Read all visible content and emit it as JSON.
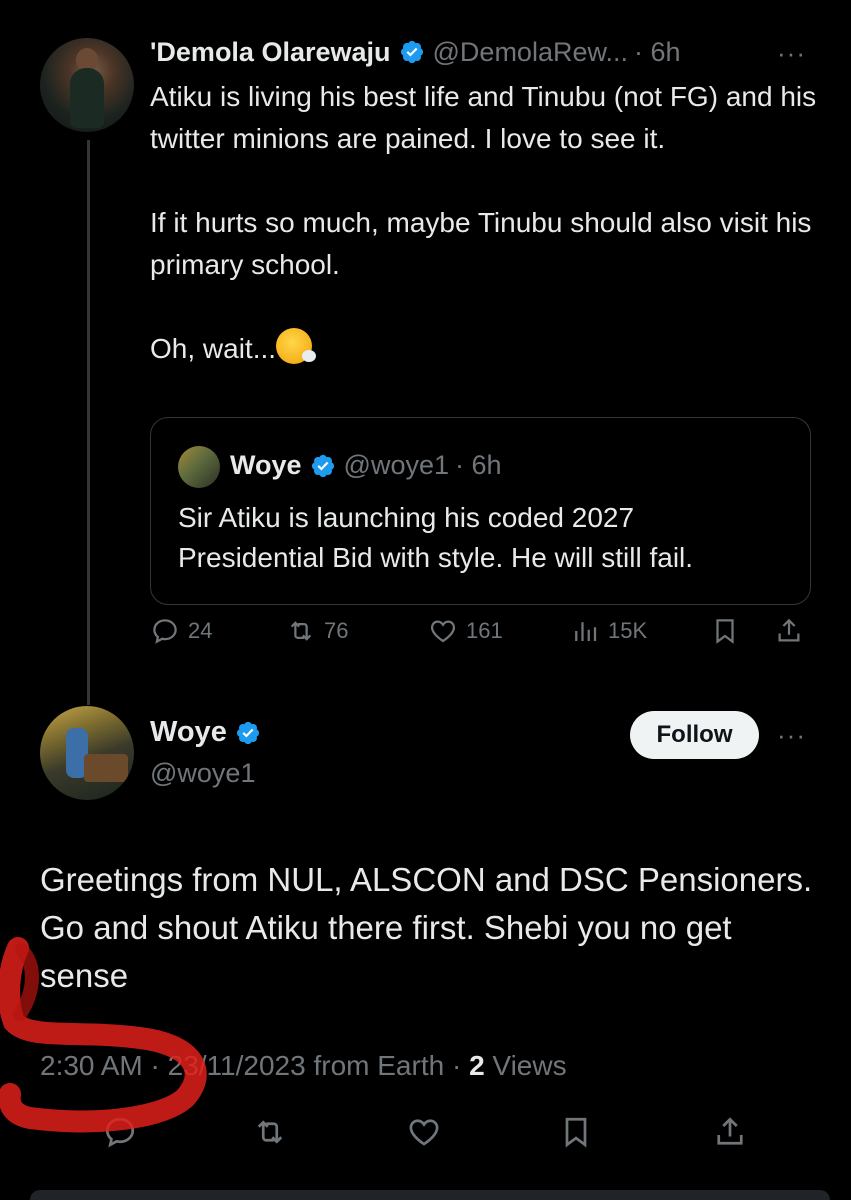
{
  "original_tweet": {
    "author_name": "'Demola Olarewaju",
    "handle": "@DemolaRew...",
    "time": "· 6h",
    "more": "···",
    "text": "Atiku is living his best life and Tinubu (not FG) and his twitter minions are pained. I love to see it.\n\nIf it hurts so much, maybe Tinubu should also visit his primary school.\n\nOh, wait...",
    "emoji": "sneezing-face",
    "quoted_tweet": {
      "author_name": "Woye",
      "handle": "@woye1",
      "time": "· 6h",
      "text": "Sir Atiku is launching his coded 2027 Presidential Bid with style. He will still fail."
    },
    "actions": {
      "replies": "24",
      "reposts": "76",
      "likes": "161",
      "views": "15K"
    }
  },
  "reply_tweet": {
    "author_name": "Woye",
    "handle": "@woye1",
    "follow_label": "Follow",
    "more": "···",
    "text": "Greetings from NUL, ALSCON and DSC Pensioners. Go and shout Atiku there first. Shebi you no get sense",
    "meta": {
      "time": "2:30 AM",
      "sep1": " · ",
      "date": "23/11/2023",
      "source": " from Earth",
      "sep2": " · ",
      "views_count": "2",
      "views_label": " Views"
    }
  },
  "colors": {
    "background": "#000000",
    "text": "#e7e9ea",
    "muted": "#71767b",
    "verified_blue": "#1d9bf0",
    "border": "#333639",
    "annotation_red": "#e0201a"
  }
}
